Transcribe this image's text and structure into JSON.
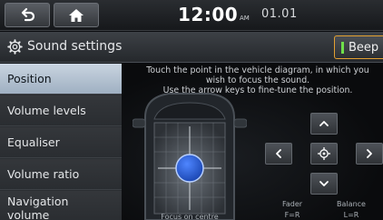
{
  "status_bar": {
    "time": "12:00",
    "ampm": "AM",
    "date": "01.01",
    "back_icon": "back-arrow-icon",
    "home_icon": "home-icon"
  },
  "header": {
    "title": "Sound settings",
    "title_icon": "gear-icon",
    "beep_label": "Beep",
    "beep_indicator_color": "#6fe04a"
  },
  "menu": {
    "items": [
      {
        "label": "Position",
        "selected": true
      },
      {
        "label": "Volume levels",
        "selected": false
      },
      {
        "label": "Equaliser",
        "selected": false
      },
      {
        "label": "Volume ratio",
        "selected": false
      },
      {
        "label": "Navigation volume",
        "selected": false
      }
    ]
  },
  "main": {
    "instruction_line1": "Touch the point in the vehicle diagram, in which you",
    "instruction_line2": "wish to focus the sound.",
    "instruction_line3": "Use the arrow keys to fine-tune the position.",
    "focus_caption": "Focus on centre",
    "fader_label": "Fader",
    "fader_value": "F=R",
    "balance_label": "Balance",
    "balance_value": "L=R",
    "focus_dot_color": "#2a63d8"
  }
}
